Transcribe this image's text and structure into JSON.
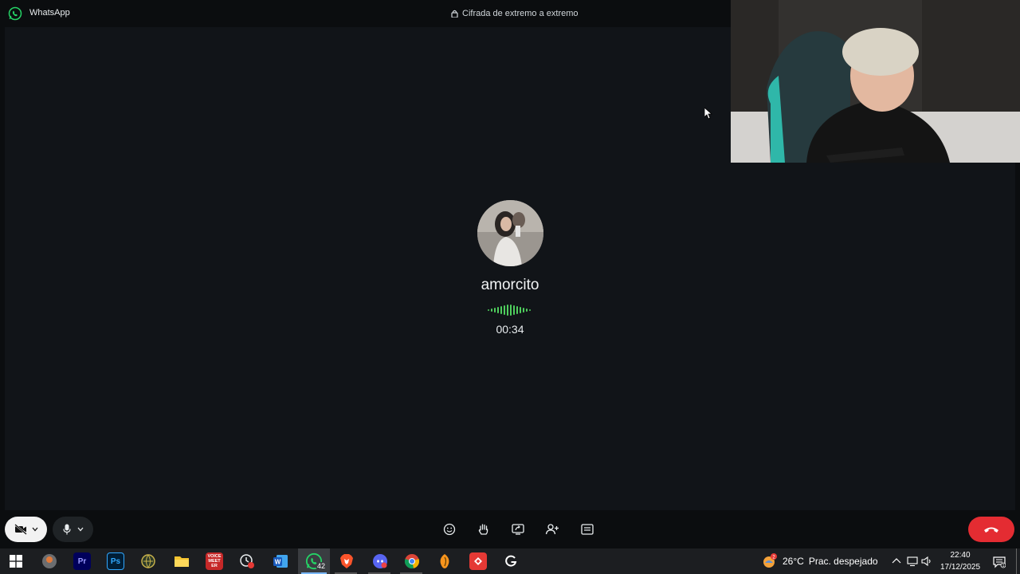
{
  "titlebar": {
    "app_name": "WhatsApp",
    "encryption_label": "Cifrada de extremo a extremo"
  },
  "call": {
    "contact_name": "amorcito",
    "duration": "00:34",
    "audio_indicator_color": "#4fce5d"
  },
  "controls": {
    "camera": "camera-off-icon",
    "microphone": "microphone-icon",
    "center": [
      "emoji-icon",
      "raise-hand-icon",
      "share-screen-icon",
      "add-participant-icon",
      "captions-icon"
    ],
    "end_call_color": "#e42c32"
  },
  "taskbar": {
    "whatsapp_badge": "42",
    "apps": [
      "windows-start",
      "app-generic",
      "premiere-pro",
      "photoshop",
      "app-globe",
      "file-explorer",
      "voicemeeter",
      "clock-app",
      "word",
      "whatsapp",
      "brave",
      "discord",
      "chrome",
      "fl-studio",
      "app-red",
      "app-g"
    ],
    "voicemeeter_label": "VOICE MEETER",
    "weather": {
      "temperature": "26°C",
      "condition": "Prac. despejado",
      "alert_count": "2"
    },
    "time": "22:40",
    "date": "17/12/2025",
    "notification_count": "1"
  }
}
